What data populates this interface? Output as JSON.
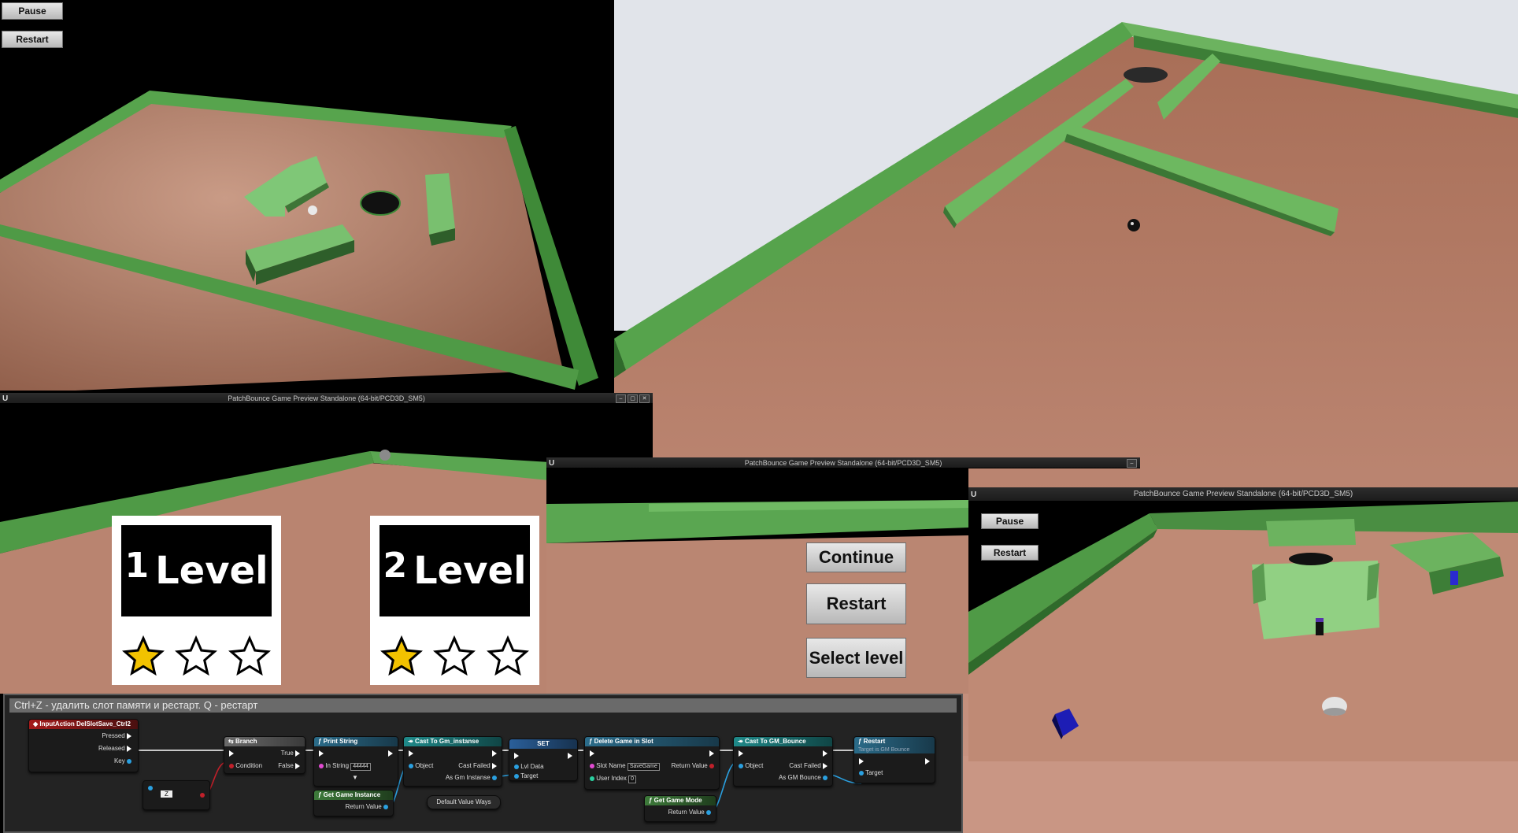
{
  "colors": {
    "floor": "#c9927a",
    "wall": "#5fa556",
    "wall_dark": "#2f6a2b",
    "sky": "#dfe3e8",
    "title_bar": "#262626",
    "star_fill": "#f2c200"
  },
  "top_left": {
    "pause_label": "Pause",
    "restart_label": "Restart"
  },
  "window_1": {
    "title": "PatchBounce Game Preview Standalone (64-bit/PCD3D_SM5)",
    "logo": "U",
    "controls": [
      "–",
      "▢",
      "✕"
    ]
  },
  "window_2": {
    "title": "PatchBounce Game Preview Standalone (64-bit/PCD3D_SM5)",
    "logo": "U",
    "controls": [
      "–"
    ]
  },
  "window_3": {
    "title": "PatchBounce Game Preview Standalone (64-bit/PCD3D_SM5)",
    "logo": "U",
    "pause_label": "Pause",
    "restart_label": "Restart"
  },
  "level_select": {
    "levels": [
      {
        "number": "1",
        "word": "Level",
        "stars_filled": 1,
        "stars_total": 3
      },
      {
        "number": "2",
        "word": "Level",
        "stars_filled": 1,
        "stars_total": 3
      }
    ]
  },
  "pause_menu": {
    "continue_label": "Continue",
    "restart_label": "Restart",
    "select_level_label": "Select level"
  },
  "blueprint": {
    "comment": "Ctrl+Z - удалить слот памяти и рестарт. Q - рестарт",
    "nodes": {
      "input_action": {
        "title": "InputAction DelSlotSave_Ctrl2",
        "pins": [
          "Pressed",
          "Released",
          "Key"
        ]
      },
      "branch": {
        "title": "Branch",
        "pins": [
          "Condition",
          "True",
          "False"
        ]
      },
      "print_string": {
        "title": "Print String",
        "in_string_label": "In String",
        "in_string_value": "44444"
      },
      "cast_gm_instance": {
        "title": "Cast To Gm_instanse",
        "pins": [
          "Object",
          "Cast Failed",
          "As Gm Instanse"
        ]
      },
      "set": {
        "title": "SET",
        "pins": [
          "Lvl Data",
          "Target"
        ]
      },
      "delete_game": {
        "title": "Delete Game in Slot",
        "slot_name_label": "Slot Name",
        "slot_name_value": "SaveGame",
        "user_index_label": "User Index",
        "user_index_value": "0",
        "return_label": "Return Value"
      },
      "cast_gm_bounce": {
        "title": "Cast To GM_Bounce",
        "pins": [
          "Object",
          "Cast Failed",
          "As GM Bounce"
        ]
      },
      "restart": {
        "title": "Restart",
        "subtitle": "Target is GM Bounce",
        "pins": [
          "Target"
        ]
      },
      "get_game_instance": {
        "title": "Get Game Instance",
        "return_label": "Return Value"
      },
      "default_value_ways": {
        "title": "Default Value Ways"
      },
      "get_game_mode": {
        "title": "Get Game Mode",
        "return_label": "Return Value"
      },
      "key_node": {
        "title": "Z"
      }
    }
  }
}
